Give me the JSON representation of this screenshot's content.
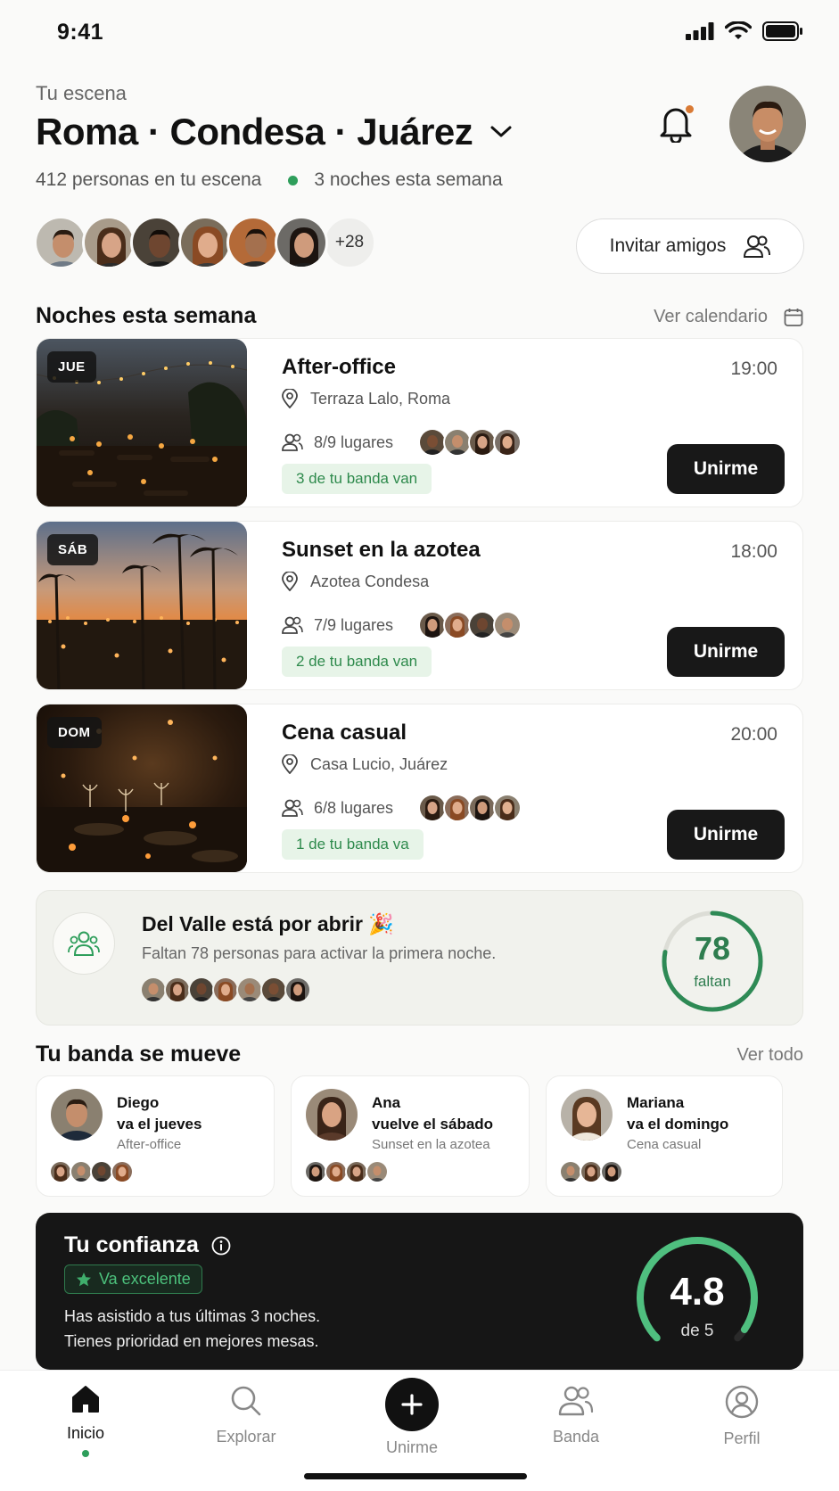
{
  "status_bar": {
    "time": "9:41"
  },
  "header": {
    "eyebrow": "Tu escena",
    "title": "Roma · Condesa · Juárez",
    "people_count": "412 personas en tu escena",
    "nights": "3 noches esta semana",
    "more_count": "+28",
    "invite_label": "Invitar amigos"
  },
  "week": {
    "title": "Noches esta semana",
    "link": "Ver calendario",
    "events": [
      {
        "day": "JUE",
        "title": "After-office",
        "time": "19:00",
        "place": "Terraza Lalo, Roma",
        "spots": "8/9 lugares",
        "badge": "3 de tu banda van",
        "cta": "Unirme"
      },
      {
        "day": "SÁB",
        "title": "Sunset en la azotea",
        "time": "18:00",
        "place": "Azotea Condesa",
        "spots": "7/9 lugares",
        "badge": "2 de tu banda van",
        "cta": "Unirme"
      },
      {
        "day": "DOM",
        "title": "Cena casual",
        "time": "20:00",
        "place": "Casa Lucio, Juárez",
        "spots": "6/8 lugares",
        "badge": "1 de tu banda va",
        "cta": "Unirme"
      }
    ]
  },
  "valle": {
    "title": "Del Valle está por abrir 🎉",
    "subtitle": "Faltan 78 personas para activar la primera noche.",
    "number": "78",
    "number_label": "faltan",
    "progress": 0.78
  },
  "banda": {
    "title": "Tu banda se mueve",
    "link": "Ver todo",
    "cards": [
      {
        "name": "Diego",
        "action": "va el jueves",
        "event": "After-office"
      },
      {
        "name": "Ana",
        "action": "vuelve el sábado",
        "event": "Sunset en la azotea"
      },
      {
        "name": "Mariana",
        "action": "va el domingo",
        "event": "Cena casual"
      }
    ]
  },
  "trust": {
    "title": "Tu confianza",
    "badge": "Va excelente",
    "line1": "Has asistido a tus últimas 3 noches.",
    "line2": "Tienes prioridad en mejores mesas.",
    "score": "4.8",
    "of": "de 5",
    "score_fraction": 0.96
  },
  "tabs": [
    {
      "label": "Inicio",
      "icon": "home-icon"
    },
    {
      "label": "Explorar",
      "icon": "search-icon"
    },
    {
      "label": "Unirme",
      "icon": "plus-icon"
    },
    {
      "label": "Banda",
      "icon": "group-icon"
    },
    {
      "label": "Perfil",
      "icon": "profile-icon"
    }
  ],
  "colors": {
    "accent_green": "#2e9e5b",
    "notification_dot": "#d97a35",
    "dark": "#161616"
  }
}
